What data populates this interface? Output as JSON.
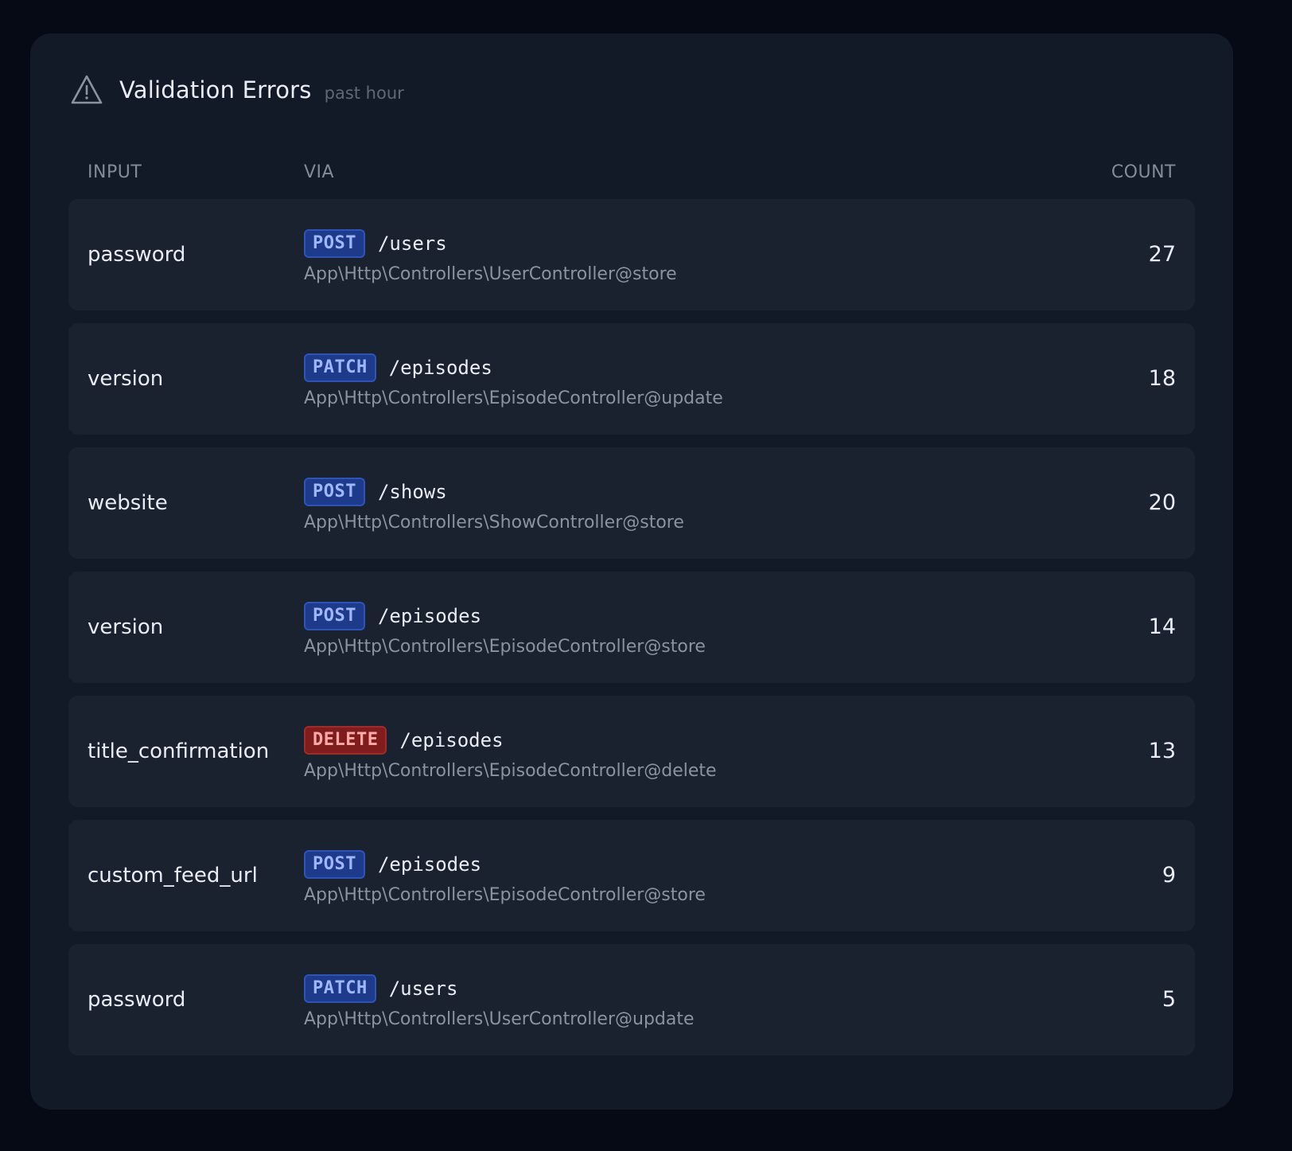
{
  "header": {
    "title": "Validation Errors",
    "subtitle": "past hour",
    "icon": "warning-icon"
  },
  "columns": {
    "input": "INPUT",
    "via": "VIA",
    "count": "COUNT"
  },
  "colors": {
    "card_bg": "#121a27",
    "row_bg": "#1a2230",
    "post_badge": "#1e3a8a",
    "patch_badge": "#1e3a8a",
    "delete_badge": "#7f1d1d"
  },
  "rows": [
    {
      "input": "password",
      "method": "POST",
      "path": "/users",
      "action": "App\\Http\\Controllers\\UserController@store",
      "count": "27"
    },
    {
      "input": "version",
      "method": "PATCH",
      "path": "/episodes",
      "action": "App\\Http\\Controllers\\EpisodeController@update",
      "count": "18"
    },
    {
      "input": "website",
      "method": "POST",
      "path": "/shows",
      "action": "App\\Http\\Controllers\\ShowController@store",
      "count": "20"
    },
    {
      "input": "version",
      "method": "POST",
      "path": "/episodes",
      "action": "App\\Http\\Controllers\\EpisodeController@store",
      "count": "14"
    },
    {
      "input": "title_confirmation",
      "method": "DELETE",
      "path": "/episodes",
      "action": "App\\Http\\Controllers\\EpisodeController@delete",
      "count": "13"
    },
    {
      "input": "custom_feed_url",
      "method": "POST",
      "path": "/episodes",
      "action": "App\\Http\\Controllers\\EpisodeController@store",
      "count": "9"
    },
    {
      "input": "password",
      "method": "PATCH",
      "path": "/users",
      "action": "App\\Http\\Controllers\\UserController@update",
      "count": "5"
    }
  ]
}
